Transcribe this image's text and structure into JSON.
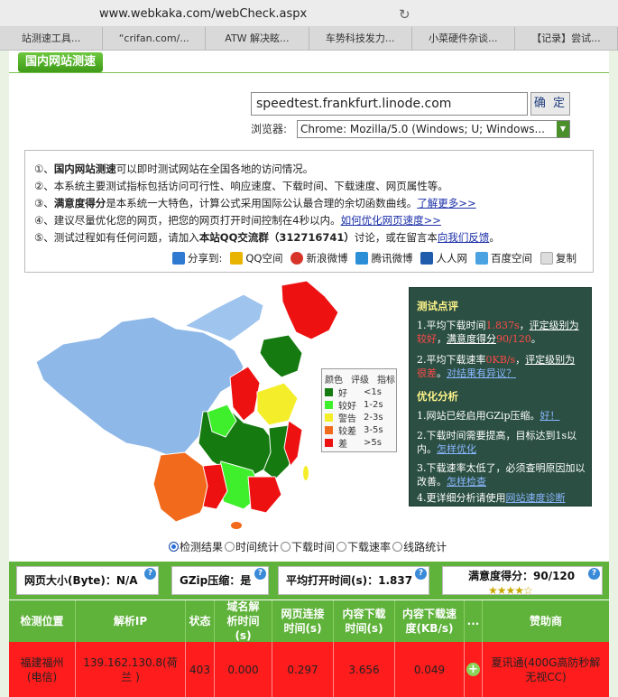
{
  "browser": {
    "url": "www.webkaka.com/webCheck.aspx",
    "reload_icon": "reload-icon",
    "tabs": [
      "站测速工具...",
      "“crifan.com/...",
      "ATW 解决眩...",
      "车势科技发力...",
      "小菜硬件杂谈...",
      "【记录】尝试..."
    ]
  },
  "section_title": "国内网站测速",
  "form": {
    "url_value": "speedtest.frankfurt.linode.com",
    "confirm_label": "确 定",
    "browser_label": "浏览器:",
    "browser_value": "Chrome: Mozilla/5.0 (Windows; U; Windows..."
  },
  "info": {
    "line1_a": "①、",
    "line1_b": "国内网站测速",
    "line1_c": "可以即时测试网站在全国各地的访问情况。",
    "line2": "②、本系统主要测试指标包括访问可行性、响应速度、下载时间、下载速度、网页属性等。",
    "line3_a": "③、",
    "line3_b": "满意度得分",
    "line3_c": "是本系统一大特色，计算公式采用国际公认最合理的余切函数曲线。",
    "line3_link": "了解更多>>",
    "line4_a": "④、建议尽量优化您的网页，把您的网页打开时间控制在4秒以内。",
    "line4_link": "如何优化网页速度>>",
    "line5_a": "⑤、测试过程如有任何问题，请加入",
    "line5_b": "本站QQ交流群",
    "line5_c": "（312716741）",
    "line5_d": "讨论，或在留言本",
    "line5_link": "向我们反馈",
    "line5_e": "。",
    "share_label": "分享到:",
    "share_items": [
      "QQ空间",
      "新浪微博",
      "腾讯微博",
      "人人网",
      "百度空间",
      "复制"
    ]
  },
  "legend": {
    "headers": [
      "颜色",
      "评级",
      "指标"
    ],
    "rows": [
      {
        "level": "好",
        "range": "<1s",
        "color": "#157a10"
      },
      {
        "level": "较好",
        "range": "1-2s",
        "color": "#3fef2c"
      },
      {
        "level": "警告",
        "range": "2-3s",
        "color": "#f4ee2a"
      },
      {
        "level": "较差",
        "range": "3-5s",
        "color": "#f26a1b"
      },
      {
        "level": "差",
        "range": ">5s",
        "color": "#ee1111"
      }
    ]
  },
  "analysis": {
    "title1": "测试点评",
    "p1_a": "1.平均下载时间",
    "p1_val": "1.837s",
    "p1_b": "，",
    "p1_c": "评定级别为",
    "p1_lvl": "较好",
    "p1_d": "，",
    "p1_e": "满意度得分",
    "p1_score": "90/120",
    "p1_f": "。",
    "p2_a": "2.平均下载速率",
    "p2_val": "0KB/s",
    "p2_b": "，",
    "p2_c": "评定级别为",
    "p2_lvl": "很差",
    "p2_d": "。",
    "p2_link": "对结果有异议？",
    "title2": "优化分析",
    "o1_a": "1.网站已经启用GZip压缩。",
    "o1_link": "好！",
    "o2_a": "2.下载时间需要提高，目标达到1s以内。",
    "o2_link": "怎样优化",
    "o3_a": "3.下载速率太低了，必须查明原因加以改善。",
    "o3_link": "怎样检查",
    "o4_a": "4.更详细分析请使用",
    "o4_link": "网站速度诊断"
  },
  "view_tabs": [
    "检测结果",
    "时间统计",
    "下载时间",
    "下载速率",
    "线路统计"
  ],
  "stats": {
    "page_size": "网页大小(Byte)：N/A",
    "gzip": "GZip压缩：是",
    "avg_open": "平均打开时间(s)：1.837",
    "satisfaction": "满意度得分：90/120",
    "stars": "★★★★☆"
  },
  "table": {
    "headers": [
      "检测位置",
      "解析IP",
      "状态",
      "域名解析时间(s)",
      "网页连接时间(s)",
      "内容下载时间(s)",
      "内容下载速度(KB/s)",
      "...",
      "赞助商"
    ],
    "row": {
      "location": "福建福州(电信)",
      "ip": "139.162.130.8(荷兰 )",
      "status": "403",
      "dns": "0.000",
      "connect": "0.297",
      "download": "3.656",
      "speed": "0.049",
      "sponsor": "夏讯通(400G高防秒解无视CC)"
    }
  }
}
